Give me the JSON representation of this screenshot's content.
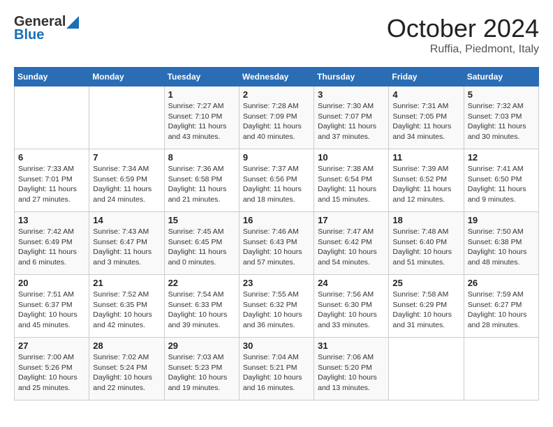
{
  "header": {
    "logo_general": "General",
    "logo_blue": "Blue",
    "month_title": "October 2024",
    "location": "Ruffia, Piedmont, Italy"
  },
  "weekdays": [
    "Sunday",
    "Monday",
    "Tuesday",
    "Wednesday",
    "Thursday",
    "Friday",
    "Saturday"
  ],
  "weeks": [
    [
      {
        "day": "",
        "info": ""
      },
      {
        "day": "",
        "info": ""
      },
      {
        "day": "1",
        "sunrise": "7:27 AM",
        "sunset": "7:10 PM",
        "daylight": "11 hours and 43 minutes."
      },
      {
        "day": "2",
        "sunrise": "7:28 AM",
        "sunset": "7:09 PM",
        "daylight": "11 hours and 40 minutes."
      },
      {
        "day": "3",
        "sunrise": "7:30 AM",
        "sunset": "7:07 PM",
        "daylight": "11 hours and 37 minutes."
      },
      {
        "day": "4",
        "sunrise": "7:31 AM",
        "sunset": "7:05 PM",
        "daylight": "11 hours and 34 minutes."
      },
      {
        "day": "5",
        "sunrise": "7:32 AM",
        "sunset": "7:03 PM",
        "daylight": "11 hours and 30 minutes."
      }
    ],
    [
      {
        "day": "6",
        "sunrise": "7:33 AM",
        "sunset": "7:01 PM",
        "daylight": "11 hours and 27 minutes."
      },
      {
        "day": "7",
        "sunrise": "7:34 AM",
        "sunset": "6:59 PM",
        "daylight": "11 hours and 24 minutes."
      },
      {
        "day": "8",
        "sunrise": "7:36 AM",
        "sunset": "6:58 PM",
        "daylight": "11 hours and 21 minutes."
      },
      {
        "day": "9",
        "sunrise": "7:37 AM",
        "sunset": "6:56 PM",
        "daylight": "11 hours and 18 minutes."
      },
      {
        "day": "10",
        "sunrise": "7:38 AM",
        "sunset": "6:54 PM",
        "daylight": "11 hours and 15 minutes."
      },
      {
        "day": "11",
        "sunrise": "7:39 AM",
        "sunset": "6:52 PM",
        "daylight": "11 hours and 12 minutes."
      },
      {
        "day": "12",
        "sunrise": "7:41 AM",
        "sunset": "6:50 PM",
        "daylight": "11 hours and 9 minutes."
      }
    ],
    [
      {
        "day": "13",
        "sunrise": "7:42 AM",
        "sunset": "6:49 PM",
        "daylight": "11 hours and 6 minutes."
      },
      {
        "day": "14",
        "sunrise": "7:43 AM",
        "sunset": "6:47 PM",
        "daylight": "11 hours and 3 minutes."
      },
      {
        "day": "15",
        "sunrise": "7:45 AM",
        "sunset": "6:45 PM",
        "daylight": "11 hours and 0 minutes."
      },
      {
        "day": "16",
        "sunrise": "7:46 AM",
        "sunset": "6:43 PM",
        "daylight": "10 hours and 57 minutes."
      },
      {
        "day": "17",
        "sunrise": "7:47 AM",
        "sunset": "6:42 PM",
        "daylight": "10 hours and 54 minutes."
      },
      {
        "day": "18",
        "sunrise": "7:48 AM",
        "sunset": "6:40 PM",
        "daylight": "10 hours and 51 minutes."
      },
      {
        "day": "19",
        "sunrise": "7:50 AM",
        "sunset": "6:38 PM",
        "daylight": "10 hours and 48 minutes."
      }
    ],
    [
      {
        "day": "20",
        "sunrise": "7:51 AM",
        "sunset": "6:37 PM",
        "daylight": "10 hours and 45 minutes."
      },
      {
        "day": "21",
        "sunrise": "7:52 AM",
        "sunset": "6:35 PM",
        "daylight": "10 hours and 42 minutes."
      },
      {
        "day": "22",
        "sunrise": "7:54 AM",
        "sunset": "6:33 PM",
        "daylight": "10 hours and 39 minutes."
      },
      {
        "day": "23",
        "sunrise": "7:55 AM",
        "sunset": "6:32 PM",
        "daylight": "10 hours and 36 minutes."
      },
      {
        "day": "24",
        "sunrise": "7:56 AM",
        "sunset": "6:30 PM",
        "daylight": "10 hours and 33 minutes."
      },
      {
        "day": "25",
        "sunrise": "7:58 AM",
        "sunset": "6:29 PM",
        "daylight": "10 hours and 31 minutes."
      },
      {
        "day": "26",
        "sunrise": "7:59 AM",
        "sunset": "6:27 PM",
        "daylight": "10 hours and 28 minutes."
      }
    ],
    [
      {
        "day": "27",
        "sunrise": "7:00 AM",
        "sunset": "5:26 PM",
        "daylight": "10 hours and 25 minutes."
      },
      {
        "day": "28",
        "sunrise": "7:02 AM",
        "sunset": "5:24 PM",
        "daylight": "10 hours and 22 minutes."
      },
      {
        "day": "29",
        "sunrise": "7:03 AM",
        "sunset": "5:23 PM",
        "daylight": "10 hours and 19 minutes."
      },
      {
        "day": "30",
        "sunrise": "7:04 AM",
        "sunset": "5:21 PM",
        "daylight": "10 hours and 16 minutes."
      },
      {
        "day": "31",
        "sunrise": "7:06 AM",
        "sunset": "5:20 PM",
        "daylight": "10 hours and 13 minutes."
      },
      {
        "day": "",
        "info": ""
      },
      {
        "day": "",
        "info": ""
      }
    ]
  ]
}
